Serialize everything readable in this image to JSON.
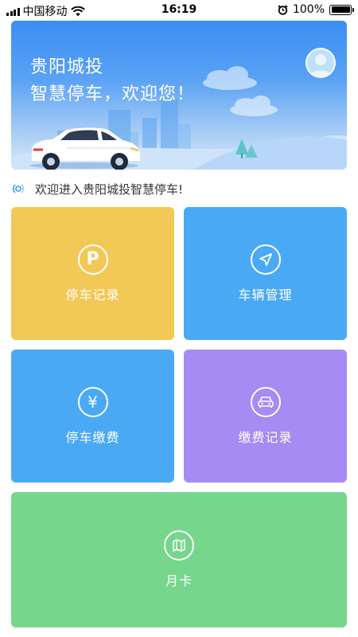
{
  "status_bar": {
    "carrier": "中国移动",
    "time": "16:19",
    "battery_text": "100%",
    "battery_level": 1.0,
    "icons": [
      "signal-icon",
      "wifi-icon",
      "alarm-icon",
      "battery-icon"
    ]
  },
  "banner": {
    "title": "贵阳城投",
    "subtitle": "智慧停车，欢迎您！",
    "avatar_icon": "user-avatar-icon"
  },
  "notice": {
    "icon": "broadcast-icon",
    "text": "欢迎进入贵阳城投智慧停车!"
  },
  "tiles": [
    {
      "label": "停车记录",
      "icon": "parking-p-icon",
      "color": "#f2c857"
    },
    {
      "label": "车辆管理",
      "icon": "navigation-arrow-icon",
      "color": "#4aa9f5"
    },
    {
      "label": "停车缴费",
      "icon": "yen-icon",
      "color": "#4aa9f5"
    },
    {
      "label": "缴费记录",
      "icon": "car-icon",
      "color": "#a48cf4"
    },
    {
      "label": "月卡",
      "icon": "map-icon",
      "color": "#76d68c"
    }
  ]
}
